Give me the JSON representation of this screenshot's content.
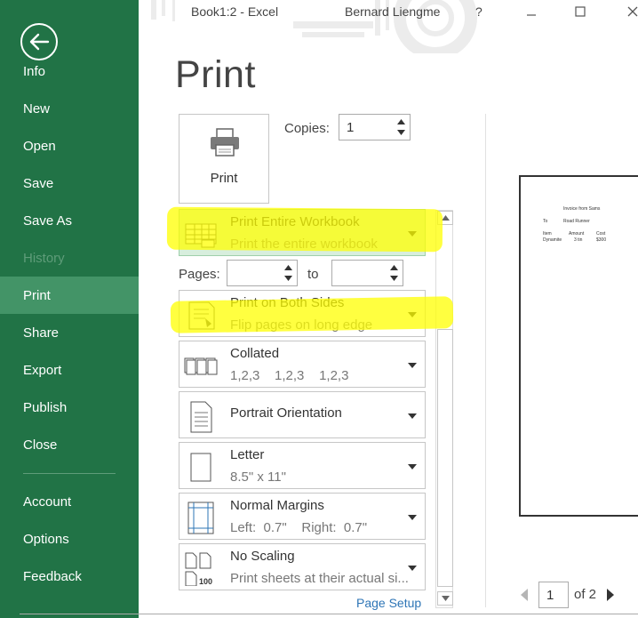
{
  "titlebar": {
    "doc_title": "Book1:2 - Excel",
    "user": "Bernard Liengme",
    "help": "?",
    "minimize_icon": "minimize-icon",
    "maximize_icon": "maximize-icon",
    "close_icon": "close-icon"
  },
  "sidebar": {
    "back_icon": "back-arrow-icon",
    "items": [
      {
        "label": "Info"
      },
      {
        "label": "New"
      },
      {
        "label": "Open"
      },
      {
        "label": "Save"
      },
      {
        "label": "Save As"
      },
      {
        "label": "History"
      },
      {
        "label": "Print"
      },
      {
        "label": "Share"
      },
      {
        "label": "Export"
      },
      {
        "label": "Publish"
      },
      {
        "label": "Close"
      },
      {
        "label": "Account"
      },
      {
        "label": "Options"
      },
      {
        "label": "Feedback"
      }
    ],
    "active": "Print",
    "disabled": "History"
  },
  "main": {
    "heading": "Print",
    "print_button_label": "Print",
    "copies_label": "Copies:",
    "copies_value": "1",
    "pages_label": "Pages:",
    "to_label": "to",
    "settings": [
      {
        "title": "Print Entire Workbook",
        "subtitle": "Print the entire workbook",
        "icon": "workbook-icon"
      },
      {
        "title": "Print on Both Sides",
        "subtitle": "Flip pages on long edge",
        "icon": "duplex-icon"
      },
      {
        "title": "Collated",
        "subtitle": "1,2,3    1,2,3    1,2,3",
        "icon": "collated-icon"
      },
      {
        "title": "Portrait Orientation",
        "subtitle": "",
        "icon": "portrait-icon"
      },
      {
        "title": "Letter",
        "subtitle": "8.5\" x 11\"",
        "icon": "letter-icon"
      },
      {
        "title": "Normal Margins",
        "subtitle": "Left:  0.7\"    Right:  0.7\"",
        "icon": "margins-icon"
      },
      {
        "title": "No Scaling",
        "subtitle": "Print sheets at their actual si...",
        "icon": "no-scaling-icon"
      }
    ],
    "page_setup_link": "Page Setup",
    "highlight_color": "#ffff00"
  },
  "preview": {
    "page_title": "Invoice from Sams",
    "to_label": "To",
    "to_value": "Road Runner",
    "col_item": "Item",
    "col_amount": "Amount",
    "col_cost": "Cost",
    "row_item": "Dynamite",
    "row_amount": "3 tin",
    "row_cost": "$300",
    "current_page": "1",
    "of_pages": "of 2"
  }
}
